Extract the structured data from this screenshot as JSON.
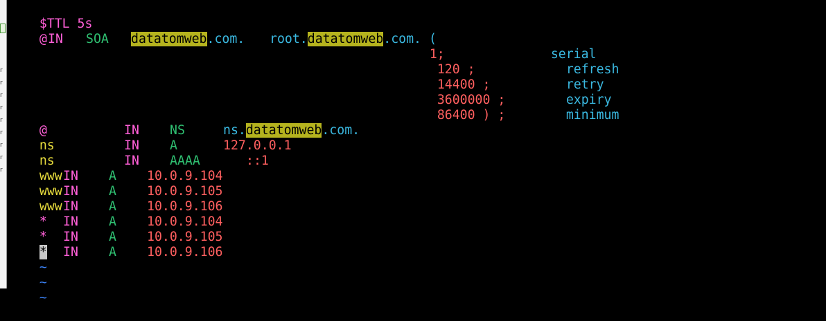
{
  "colors": {
    "background": "#000000",
    "directive": "#ff5fd7",
    "owner": "#e6db3c",
    "record_type": "#2fbf71",
    "domain": "#3ab8e0",
    "value": "#ff5f5f",
    "search_highlight": "#b5b31e",
    "tilde": "#3b82f6"
  },
  "search_term": "datatomweb",
  "zone": {
    "ttl_line": "$TTL 5s",
    "soa": {
      "owner": "@",
      "class": "IN",
      "type": "SOA",
      "mname_prefix": "",
      "mname_suffix": ".com.",
      "rname_prefix": "root.",
      "rname_suffix": ".com.",
      "open_paren": "("
    },
    "soa_fields": [
      {
        "value": "1;",
        "comment": "serial"
      },
      {
        "value": "120 ;",
        "comment": "refresh"
      },
      {
        "value": "14400 ;",
        "comment": "retry"
      },
      {
        "value": "3600000 ;",
        "comment": "expiry"
      },
      {
        "value": "86400 ) ;",
        "comment": "minimum"
      }
    ],
    "ns_record": {
      "owner": "@",
      "class": "IN",
      "type": "NS",
      "prefix": "ns.",
      "suffix": ".com."
    },
    "ns_a_record": {
      "owner": "ns",
      "class": "IN",
      "type": "A",
      "value": "127.0.0.1"
    },
    "ns_aaaa_record": {
      "owner": "ns",
      "class": "IN",
      "type": "AAAA",
      "value": "::1"
    },
    "a_records": [
      {
        "owner": "www",
        "class": "IN",
        "type": "A",
        "value": "10.0.9.104"
      },
      {
        "owner": "www",
        "class": "IN",
        "type": "A",
        "value": "10.0.9.105"
      },
      {
        "owner": "www",
        "class": "IN",
        "type": "A",
        "value": "10.0.9.106"
      },
      {
        "owner": "*",
        "class": "IN",
        "type": "A",
        "value": "10.0.9.104"
      },
      {
        "owner": "*",
        "class": "IN",
        "type": "A",
        "value": "10.0.9.105"
      },
      {
        "owner": "*",
        "class": "IN",
        "type": "A",
        "value": "10.0.9.106"
      }
    ],
    "empty_line_marker": "~"
  }
}
